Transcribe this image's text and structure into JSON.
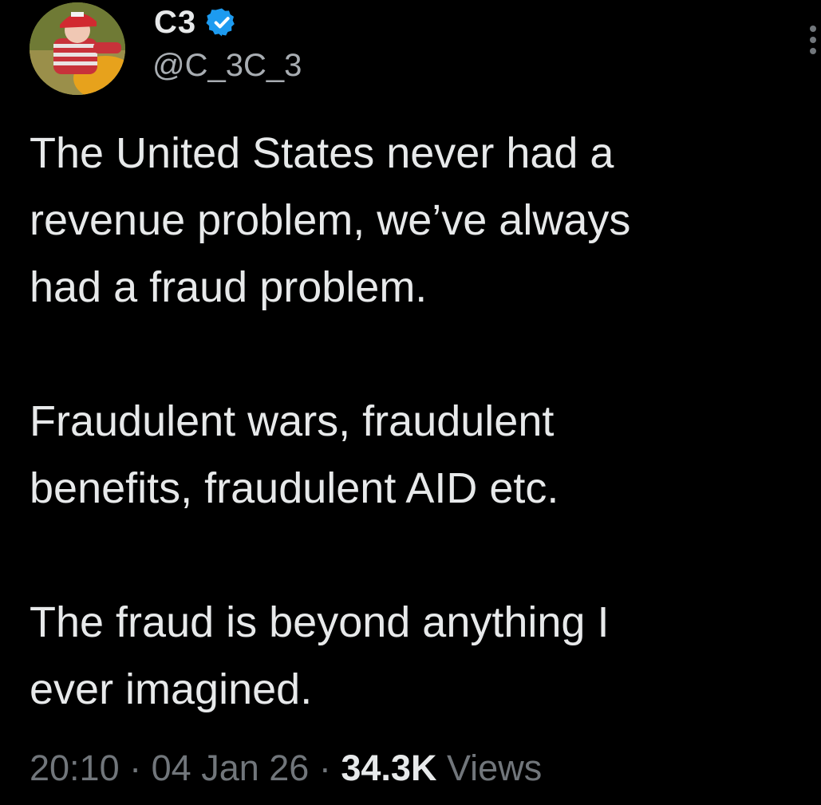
{
  "author": {
    "display_name": "C3",
    "handle": "@C_3C_3",
    "verified_icon": "verified-badge-icon",
    "avatar": "profile-photo"
  },
  "tweet": {
    "paragraphs": [
      [
        "The United States never had a",
        "revenue problem, we’ve always",
        "had a fraud problem."
      ],
      [
        "Fraudulent wars, fraudulent",
        "benefits, fraudulent AID etc."
      ],
      [
        "The fraud is beyond anything I",
        "ever imagined."
      ]
    ]
  },
  "meta": {
    "time": "20:10",
    "separator": "·",
    "date": "04 Jan 26",
    "views_count": "34.3K",
    "views_label": "Views"
  },
  "colors": {
    "background": "#000000",
    "text": "#e7e9ea",
    "secondary_text": "#71767b",
    "verified_badge": "#1d9bf0"
  },
  "icons": {
    "more": "more-options-icon"
  }
}
